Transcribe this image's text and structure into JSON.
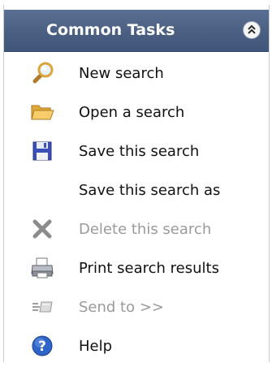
{
  "panel": {
    "title": "Common Tasks",
    "collapse_icon": "double-chevron-up-icon"
  },
  "items": [
    {
      "label": "New search",
      "icon": "magnifier-icon",
      "enabled": true
    },
    {
      "label": "Open a search",
      "icon": "folder-open-icon",
      "enabled": true
    },
    {
      "label": "Save this search",
      "icon": "floppy-disk-icon",
      "enabled": true
    },
    {
      "label": "Save this search as",
      "icon": "",
      "enabled": true
    },
    {
      "label": "Delete this search",
      "icon": "delete-x-icon",
      "enabled": false
    },
    {
      "label": "Print search results",
      "icon": "printer-icon",
      "enabled": true
    },
    {
      "label": "Send to >>",
      "icon": "send-icon",
      "enabled": false
    },
    {
      "label": "Help",
      "icon": "help-icon",
      "enabled": true
    }
  ],
  "colors": {
    "header_bg": "#4a5f82",
    "header_text": "#ffffff",
    "disabled_text": "#9a9a9a",
    "enabled_text": "#111111"
  }
}
